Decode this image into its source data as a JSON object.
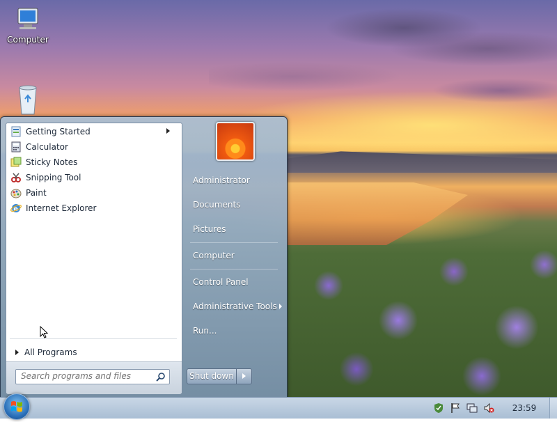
{
  "desktop": {
    "icons": [
      {
        "label": "Computer",
        "icon": "computer-icon"
      },
      {
        "label": "",
        "icon": "recycle-bin-icon"
      }
    ]
  },
  "start_menu": {
    "programs": [
      {
        "label": "Getting Started",
        "icon": "getting-started-icon",
        "has_submenu": true
      },
      {
        "label": "Calculator",
        "icon": "calculator-icon",
        "has_submenu": false
      },
      {
        "label": "Sticky Notes",
        "icon": "sticky-notes-icon",
        "has_submenu": false
      },
      {
        "label": "Snipping Tool",
        "icon": "snipping-tool-icon",
        "has_submenu": false
      },
      {
        "label": "Paint",
        "icon": "paint-icon",
        "has_submenu": false
      },
      {
        "label": "Internet Explorer",
        "icon": "internet-explorer-icon",
        "has_submenu": false
      }
    ],
    "all_programs_label": "All Programs",
    "search": {
      "placeholder": "Search programs and files",
      "value": ""
    },
    "right_items": [
      {
        "label": "Administrator",
        "has_submenu": false
      },
      {
        "label": "Documents",
        "has_submenu": false
      },
      {
        "label": "Pictures",
        "has_submenu": false
      },
      {
        "label": "Computer",
        "has_submenu": false
      },
      {
        "label": "Control Panel",
        "has_submenu": false
      },
      {
        "label": "Administrative Tools",
        "has_submenu": true
      },
      {
        "label": "Run...",
        "has_submenu": false
      }
    ],
    "shutdown_label": "Shut down"
  },
  "taskbar": {
    "tray_icons": [
      "security-shield-icon",
      "action-center-flag-icon",
      "network-icon",
      "volume-muted-icon"
    ],
    "clock": "23:59"
  },
  "colors": {
    "taskbar": "#b8cadc",
    "start_menu_pane": "#ffffff",
    "accent_orb": "#2a6fb8"
  }
}
